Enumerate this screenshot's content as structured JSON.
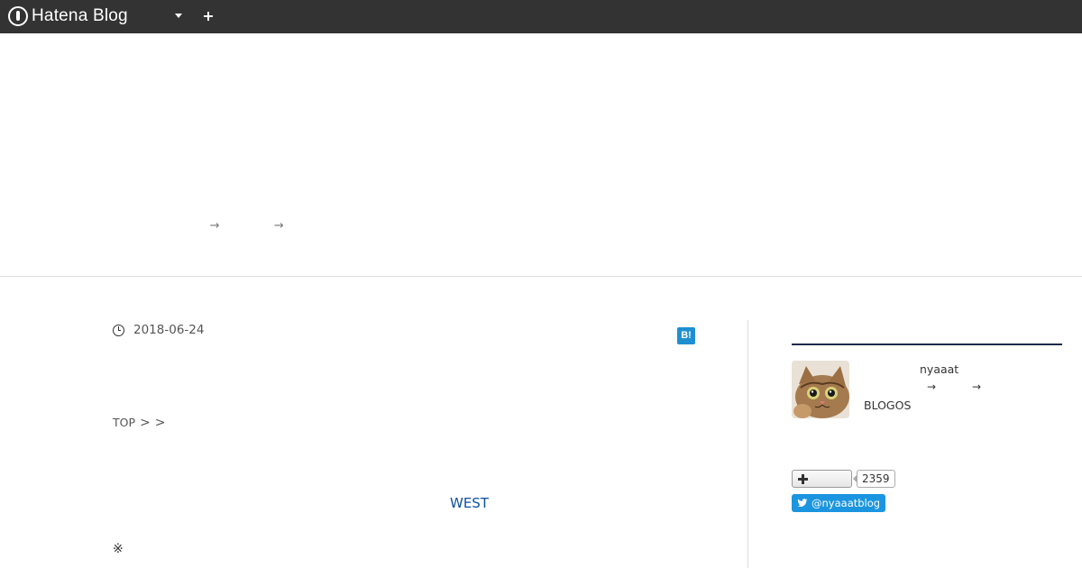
{
  "topbar": {
    "brand": "Hatena Blog",
    "icons": {
      "logo": "hatena-logo-icon",
      "menu": "chevron-down-icon",
      "add": "plus-icon"
    }
  },
  "header": {
    "description": "ﾠﾠﾠﾠﾠﾠﾠﾠﾠ→ﾠﾠﾠﾠﾠ→ﾠﾠﾠﾠﾠﾠﾠﾠﾠﾠﾠﾠﾠﾠﾠﾠﾠﾠﾠﾠﾠﾠﾠﾠﾠﾠﾠﾠﾠﾠﾠ"
  },
  "entry": {
    "date": "2018-06-24",
    "hatebu_label": "B!",
    "title": "ﾠﾠﾠﾠﾠﾠﾠﾠﾠﾠﾠﾠﾠﾠﾠﾠﾠﾠﾠﾠﾠﾠﾠﾠﾠﾠﾠﾠﾠﾠﾠﾠﾠﾠ",
    "breadcrumb": [
      "TOP",
      ">",
      ">"
    ],
    "link_text": "WEST",
    "note_mark": "※"
  },
  "sidebar": {
    "profile_heading": "ﾠﾠﾠﾠﾠ",
    "profile": {
      "name": "nyaaat",
      "arrow_1": "→",
      "arrow_2": "→",
      "blogos": "BLOGOS"
    },
    "follow": {
      "count": "2359"
    },
    "twitter": {
      "handle": "@nyaaatblog"
    },
    "next_heading": "ﾠﾠﾠ"
  },
  "colors": {
    "topbar": "#333333",
    "hatebu": "#1f8fd1",
    "twitter": "#1b95e0",
    "link": "#0d4fa0",
    "heading_rule": "#1c2a4a"
  }
}
